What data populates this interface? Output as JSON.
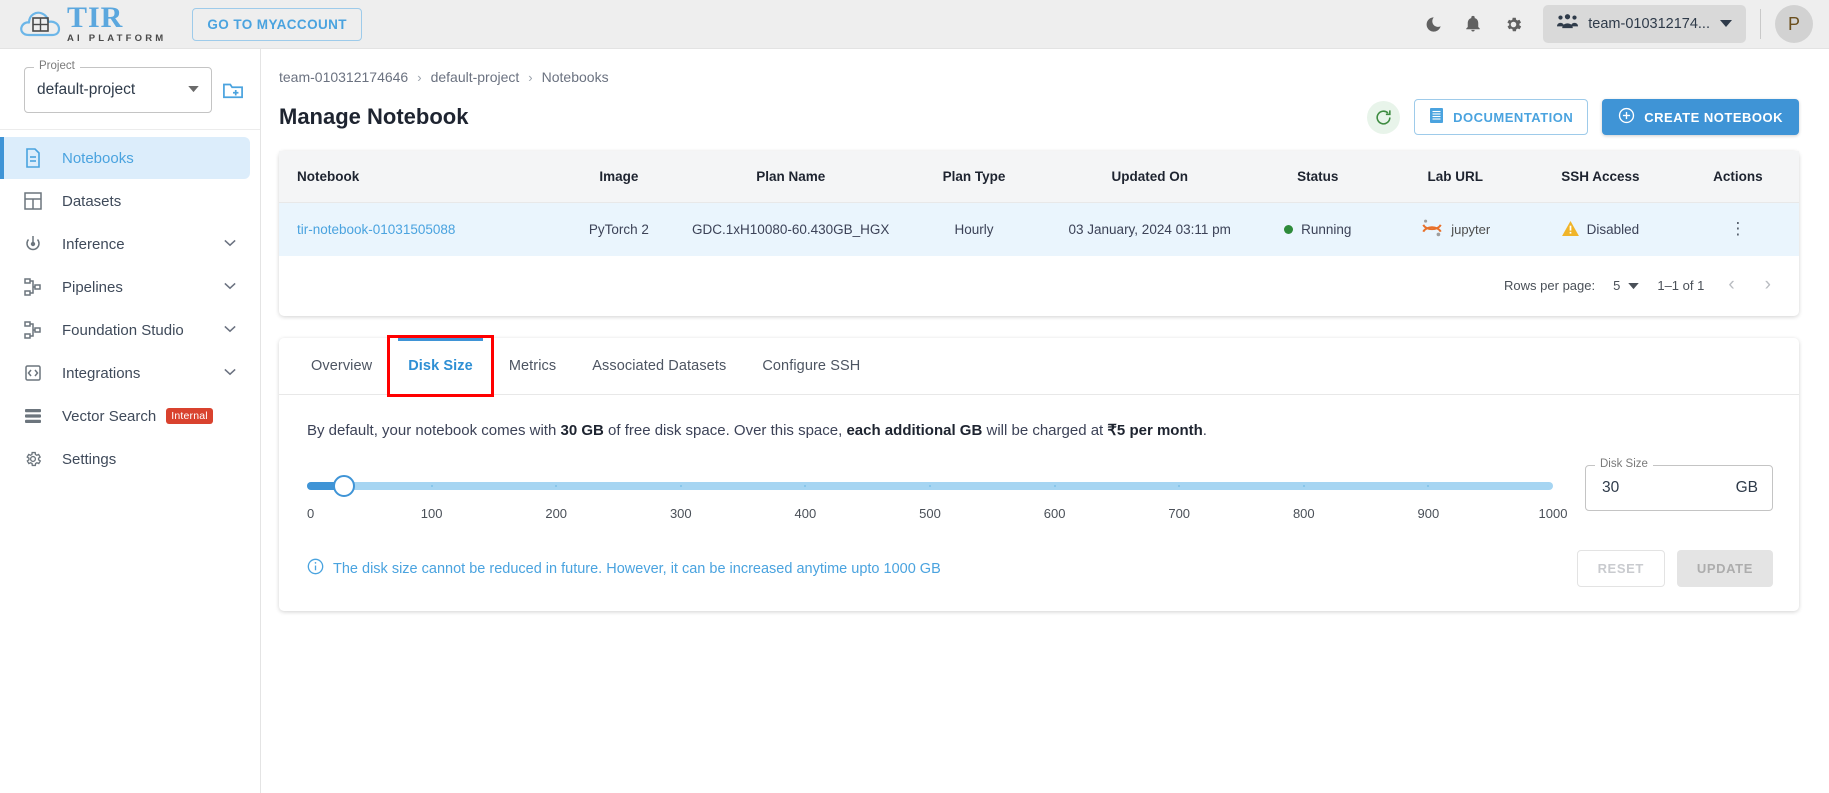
{
  "topbar": {
    "brand_name": "TIR",
    "brand_sub": "AI PLATFORM",
    "goto_label": "GO TO MYACCOUNT",
    "icons": [
      "dark-mode-icon",
      "notifications-icon",
      "settings-icon"
    ],
    "team_name": "team-010312174...",
    "avatar_initial": "P"
  },
  "sidebar": {
    "project_label": "Project",
    "project_value": "default-project",
    "new_folder_icon": "new-folder-icon",
    "items": [
      {
        "label": "Notebooks",
        "icon": "document-icon",
        "active": true,
        "expandable": false,
        "badge": ""
      },
      {
        "label": "Datasets",
        "icon": "grid-icon",
        "active": false,
        "expandable": false,
        "badge": ""
      },
      {
        "label": "Inference",
        "icon": "inference-icon",
        "active": false,
        "expandable": true,
        "badge": ""
      },
      {
        "label": "Pipelines",
        "icon": "pipeline-icon",
        "active": false,
        "expandable": true,
        "badge": ""
      },
      {
        "label": "Foundation Studio",
        "icon": "pipeline-icon",
        "active": false,
        "expandable": true,
        "badge": ""
      },
      {
        "label": "Integrations",
        "icon": "code-icon",
        "active": false,
        "expandable": true,
        "badge": ""
      },
      {
        "label": "Vector Search",
        "icon": "database-icon",
        "active": false,
        "expandable": false,
        "badge": "Internal"
      },
      {
        "label": "Settings",
        "icon": "gear-icon",
        "active": false,
        "expandable": false,
        "badge": ""
      }
    ]
  },
  "breadcrumb": [
    "team-010312174646",
    "default-project",
    "Notebooks"
  ],
  "header": {
    "page_title": "Manage Notebook",
    "refresh_icon": "refresh-icon",
    "documentation_label": "DOCUMENTATION",
    "documentation_icon": "document-icon",
    "create_label": "CREATE NOTEBOOK",
    "create_icon": "plus-circle-icon"
  },
  "table": {
    "columns": [
      "Notebook",
      "Image",
      "Plan Name",
      "Plan Type",
      "Updated On",
      "Status",
      "Lab URL",
      "SSH Access",
      "Actions"
    ],
    "rows": [
      {
        "notebook": "tir-notebook-01031505088",
        "image": "PyTorch 2",
        "plan_name": "GDC.1xH10080-60.430GB_HGX",
        "plan_type": "Hourly",
        "updated_on": "03 January, 2024 03:11 pm",
        "status": "Running",
        "status_color": "#2e8b3a",
        "lab_url": "jupyter",
        "ssh_access": "Disabled",
        "actions_icon": "kebab-menu-icon"
      }
    ]
  },
  "pagination": {
    "rows_per_page_label": "Rows per page:",
    "rows_per_page_value": "5",
    "range_label": "1–1 of 1",
    "prev_icon": "chevron-left-icon",
    "next_icon": "chevron-right-icon"
  },
  "tabs": [
    {
      "label": "Overview",
      "active": false,
      "highlighted": false
    },
    {
      "label": "Disk Size",
      "active": true,
      "highlighted": true
    },
    {
      "label": "Metrics",
      "active": false,
      "highlighted": false
    },
    {
      "label": "Associated Datasets",
      "active": false,
      "highlighted": false
    },
    {
      "label": "Configure SSH",
      "active": false,
      "highlighted": false
    }
  ],
  "disk_size_panel": {
    "description_parts": [
      {
        "text": "By default, your notebook comes with ",
        "bold": false
      },
      {
        "text": "30 GB",
        "bold": true
      },
      {
        "text": " of free disk space. Over this space, ",
        "bold": false
      },
      {
        "text": "each additional GB",
        "bold": true
      },
      {
        "text": " will be charged at ",
        "bold": false
      },
      {
        "text": "₹5 per month",
        "bold": true
      },
      {
        "text": ".",
        "bold": false
      }
    ],
    "slider": {
      "min": 0,
      "max": 1000,
      "value": 30,
      "tick_labels": [
        "0",
        "100",
        "200",
        "300",
        "400",
        "500",
        "600",
        "700",
        "800",
        "900",
        "1000"
      ],
      "track_color": "#a6d5f2",
      "fill_color": "#3f94d6"
    },
    "field": {
      "label": "Disk Size",
      "value": "30",
      "unit": "GB"
    },
    "note_icon": "info-icon",
    "note": "The disk size cannot be reduced in future. However, it can be increased anytime upto 1000 GB",
    "reset_label": "RESET",
    "update_label": "UPDATE"
  },
  "colors": {
    "accent": "#3f94d6",
    "link": "#4aa3df",
    "highlight_box": "#ff0000",
    "warning": "#f0b429",
    "success": "#2e8b3a"
  }
}
